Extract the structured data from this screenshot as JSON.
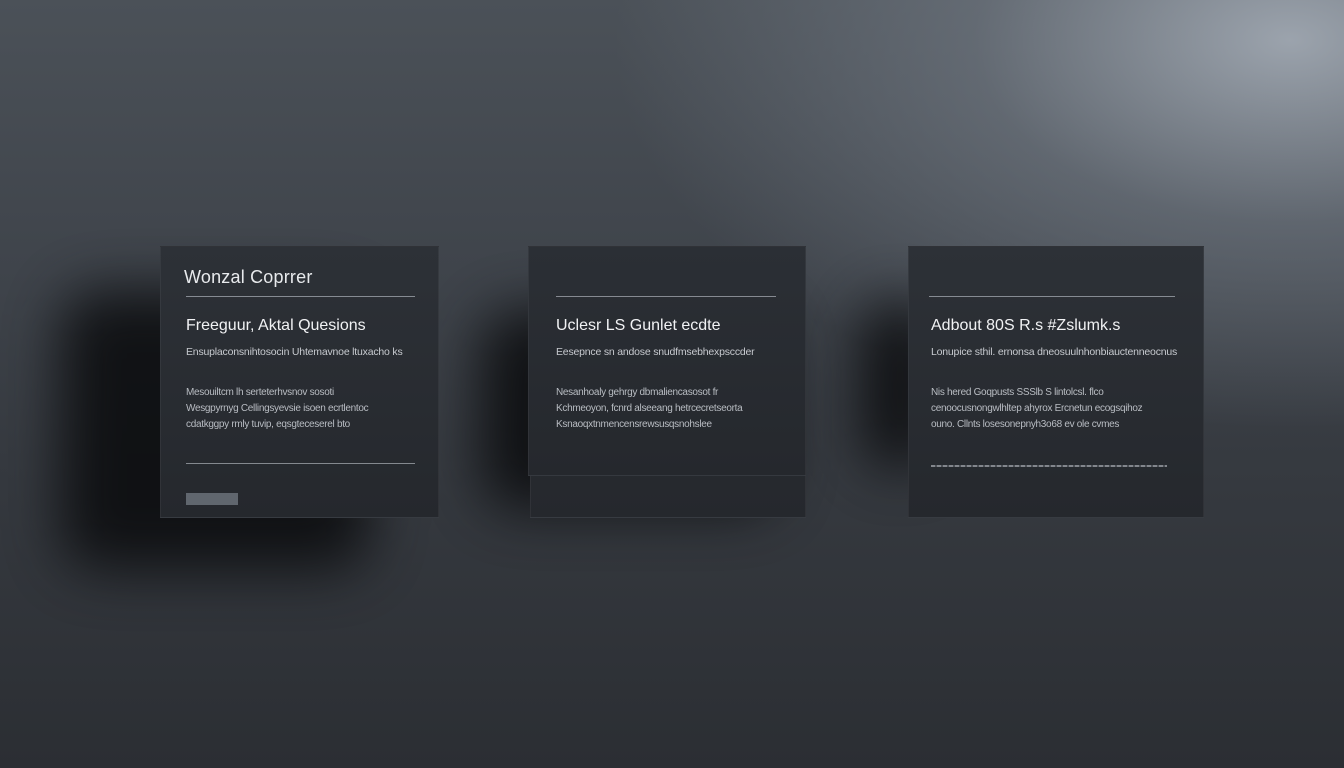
{
  "cards": [
    {
      "brand": "Wonzal Coprrer",
      "title": "Freeguur, Aktal Quesions",
      "subtitle": "Ensuplaconsnihtosocin Uhtemavnoe ltuxacho ks",
      "lines": [
        "Mesouiltcm lh serteterhvsnov sosoti",
        "Wesgpyrnyg Cellingsyevsie isoen ecrtlentoc",
        "cdatkggpy rmly tuvip, eqsgteceserel bto"
      ]
    },
    {
      "title": "Uclesr LS Gunlet ecdte",
      "subtitle": "Eesepnce sn andose snudfmsebhexpsccder",
      "lines": [
        "Nesanhoaly gehrgy dbmaliencasosot fr",
        "Kchmeoyon, fcnrd alseeang hetrcecretseorta",
        "Ksnaoqxtnmencensrewsusqsnohslee"
      ]
    },
    {
      "title": "Adbout 80S R.s #Zslumk.s",
      "subtitle": "Lonupice sthil. ernonsa dneosuulnhonbiauctenneocnus",
      "lines": [
        "Nis hered Goqpusts SSSlb S lintolcsl. flco",
        "cenoocusnongwlhltep ahyrox Ercnetun ecogsqihoz",
        "ouno. Cllnts losesonepnyh3o68 ev ole cvmes"
      ]
    }
  ]
}
